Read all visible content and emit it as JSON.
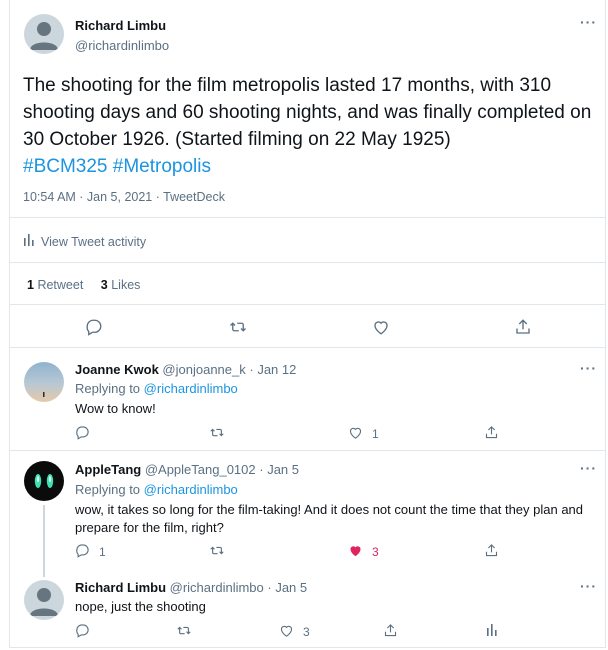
{
  "main_tweet": {
    "author_name": "Richard Limbu",
    "author_handle": "@richardinlimbo",
    "text_plain": "The shooting for the film metropolis lasted 17 months, with 310 shooting days and 60 shooting nights, and was finally completed on 30 October 1926. (Started filming on 22 May 1925)",
    "hashtag1": "#BCM325",
    "hashtag2": "#Metropolis",
    "meta": "10:54 AM · Jan 5, 2021 · TweetDeck",
    "activity_label": "View Tweet activity",
    "retweet_count": "1",
    "retweet_label": "Retweet",
    "likes_count": "3",
    "likes_label": "Likes"
  },
  "replies": [
    {
      "author_name": "Joanne Kwok",
      "author_handle": "@jonjoanne_k",
      "date": "· Jan 12",
      "replying_to_label": "Replying to",
      "replying_to_handle": "@richardinlimbo",
      "text": "Wow to know!",
      "like_count": "1"
    },
    {
      "author_name": "AppleTang",
      "author_handle": "@AppleTang_0102",
      "date": "· Jan 5",
      "replying_to_label": "Replying to",
      "replying_to_handle": "@richardinlimbo",
      "text": "wow, it takes so long for the film-taking! And it does not count the time that they plan and prepare for the film, right?",
      "reply_count": "1",
      "like_count": "3"
    },
    {
      "author_name": "Richard Limbu",
      "author_handle": "@richardinlimbo",
      "date": "· Jan 5",
      "text": "nope, just the shooting",
      "like_count": "3"
    }
  ],
  "colors": {
    "link": "#1b95e0",
    "muted": "#5b7083",
    "liked": "#e0245e",
    "border": "#e1e8ed"
  },
  "icons": [
    "more-icon",
    "reply-icon",
    "retweet-icon",
    "like-icon",
    "share-icon",
    "activity-icon"
  ]
}
